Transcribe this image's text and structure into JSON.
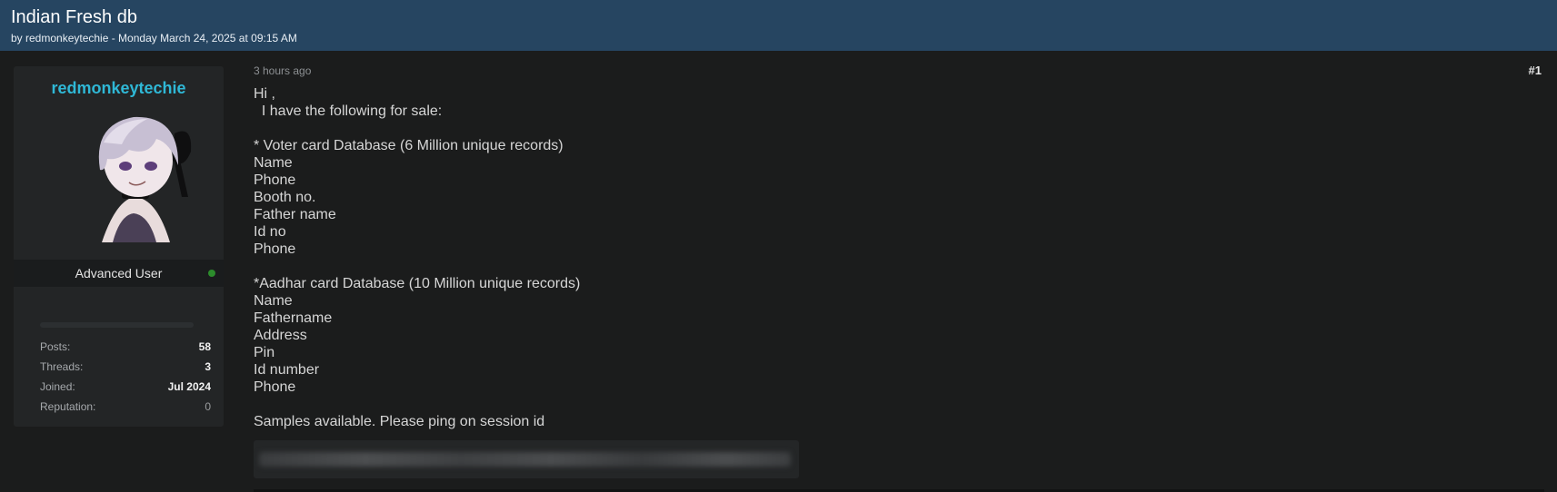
{
  "thread": {
    "title": "Indian Fresh db",
    "meta": "by redmonkeytechie - Monday March 24, 2025 at 09:15 AM"
  },
  "author": {
    "username": "redmonkeytechie",
    "rank": "Advanced User",
    "status_color": "#2c8c2c",
    "reputation_progress": 0,
    "stats": [
      {
        "label": "Posts:",
        "value": "58"
      },
      {
        "label": "Threads:",
        "value": "3"
      },
      {
        "label": "Joined:",
        "value": "Jul 2024"
      },
      {
        "label": "Reputation:",
        "value": "0"
      }
    ]
  },
  "post": {
    "time": "3 hours ago",
    "number": "#1",
    "lines": [
      "Hi ,",
      "  I have the following for sale:",
      "",
      "* Voter card Database (6 Million unique records)",
      "Name",
      "Phone",
      "Booth no.",
      "Father name",
      "Id no",
      "Phone",
      "",
      "*Aadhar card Database (10 Million unique records)",
      "Name",
      "Fathername",
      "Address",
      "Pin",
      "Id number",
      "Phone",
      "",
      "Samples available. Please ping on session id"
    ]
  },
  "colors": {
    "header_bg": "#264561",
    "page_bg": "#1b1c1c",
    "username": "#2fb8d6"
  }
}
